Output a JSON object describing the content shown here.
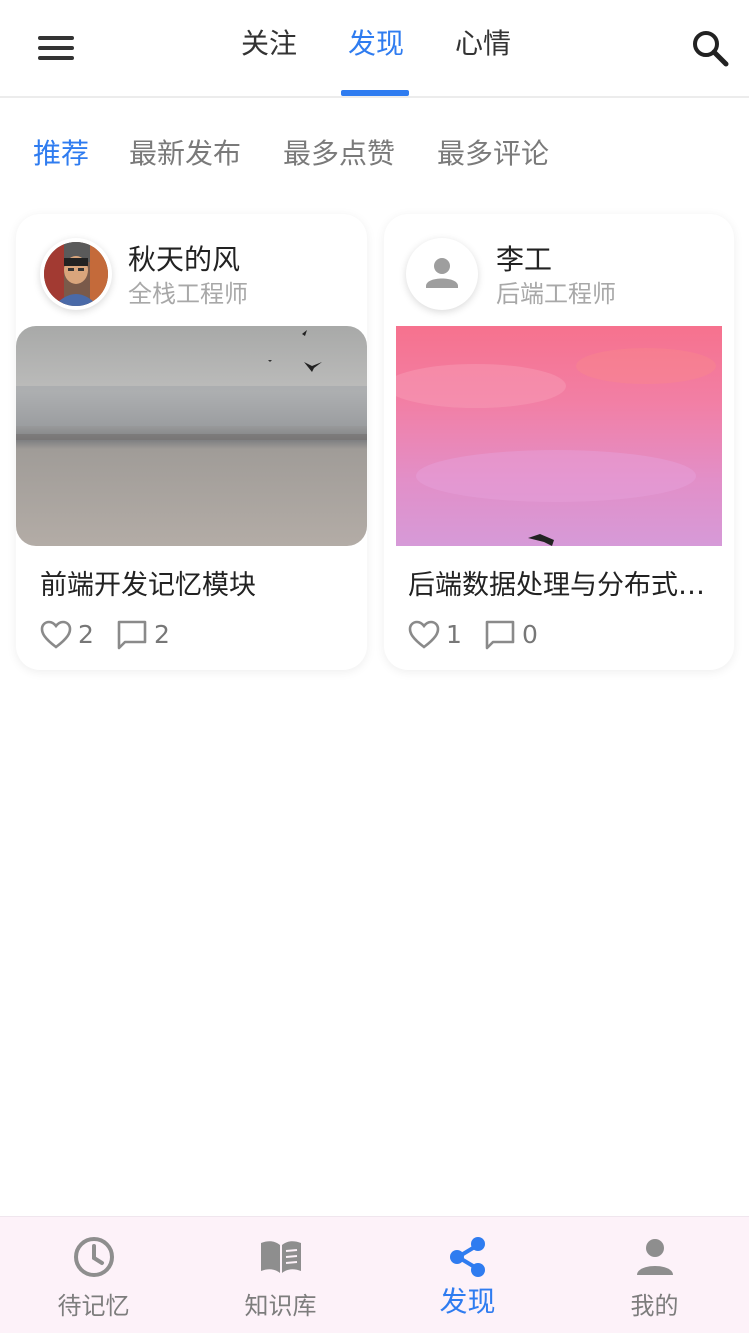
{
  "header": {
    "tabs": [
      {
        "label": "关注",
        "active": false
      },
      {
        "label": "发现",
        "active": true
      },
      {
        "label": "心情",
        "active": false
      }
    ],
    "menu_icon": "hamburger-menu-icon",
    "search_icon": "search-icon"
  },
  "filters": [
    {
      "label": "推荐",
      "active": true
    },
    {
      "label": "最新发布",
      "active": false
    },
    {
      "label": "最多点赞",
      "active": false
    },
    {
      "label": "最多评论",
      "active": false
    }
  ],
  "posts": [
    {
      "author": "秋天的风",
      "role": "全栈工程师",
      "title": "前端开发记忆模块",
      "likes": "2",
      "comments": "2",
      "avatar": "photo-avatar",
      "cover": "misty-lake-birds"
    },
    {
      "author": "李工",
      "role": "后端工程师",
      "title": "后端数据处理与分布式存储",
      "likes": "1",
      "comments": "0",
      "avatar": "person-placeholder-icon",
      "cover": "pink-sky-bird"
    }
  ],
  "bottom_nav": [
    {
      "label": "待记忆",
      "icon": "clock-icon",
      "active": false
    },
    {
      "label": "知识库",
      "icon": "book-icon",
      "active": false
    },
    {
      "label": "发现",
      "icon": "share-icon",
      "active": true
    },
    {
      "label": "我的",
      "icon": "person-icon",
      "active": false
    }
  ],
  "colors": {
    "accent": "#2f7cf0",
    "inactive": "#7d7d7d",
    "nav_bg": "#fdf2f9"
  }
}
